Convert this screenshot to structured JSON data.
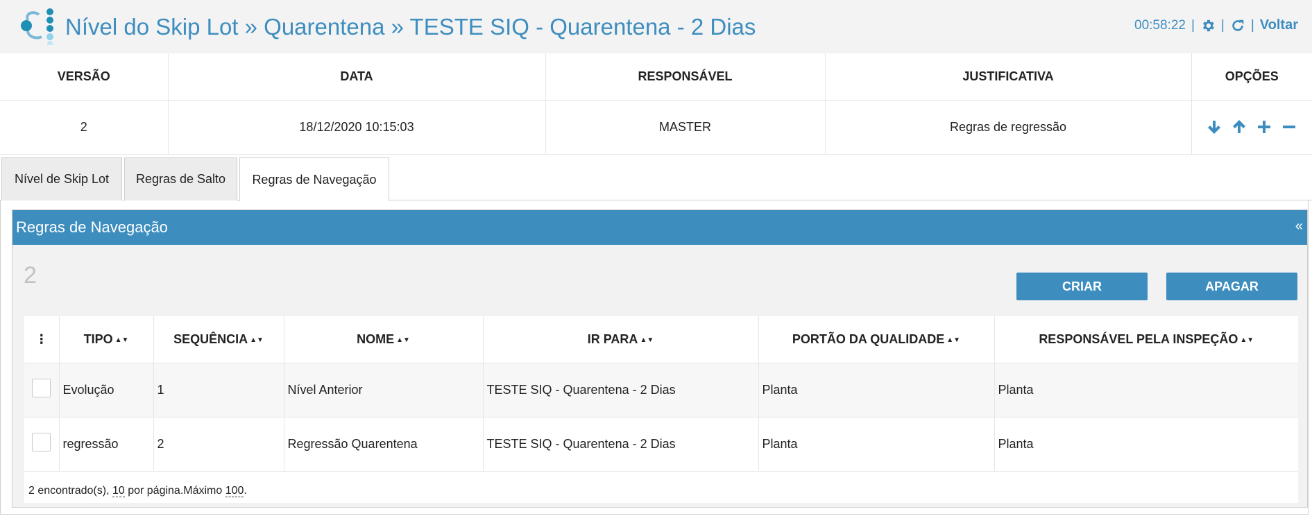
{
  "header": {
    "title": "Nível do Skip Lot » Quarentena » TESTE SIQ - Quarentena - 2 Dias",
    "timer": "00:58:22",
    "sep": "|",
    "voltar": "Voltar",
    "accent": "#3d8dbf"
  },
  "version_table": {
    "headers": [
      "VERSÃO",
      "DATA",
      "RESPONSÁVEL",
      "JUSTIFICATIVA",
      "OPÇÕES"
    ],
    "row": {
      "versao": "2",
      "data": "18/12/2020 10:15:03",
      "responsavel": "MASTER",
      "justificativa": "Regras de regressão"
    },
    "option_icons": [
      "arrow-down-icon",
      "arrow-up-icon",
      "plus-icon",
      "minus-icon"
    ]
  },
  "tabs": [
    {
      "label": "Nível de Skip Lot"
    },
    {
      "label": "Regras de Salto"
    },
    {
      "label": "Regras de Navegação"
    }
  ],
  "panel": {
    "title": "Regras de Navegação",
    "collapse": "«",
    "count": "2",
    "create_label": "CRIAR",
    "delete_label": "APAGAR"
  },
  "data_table": {
    "menu": "⋮",
    "columns": [
      "TIPO",
      "SEQUÊNCIA",
      "NOME",
      "IR PARA",
      "PORTÃO DA QUALIDADE",
      "RESPONSÁVEL PELA INSPEÇÃO"
    ],
    "rows": [
      [
        "Evolução",
        "1",
        "Nível Anterior",
        "TESTE SIQ - Quarentena - 2 Dias",
        "Planta",
        "Planta"
      ],
      [
        "regressão",
        "2",
        "Regressão Quarentena",
        "TESTE SIQ - Quarentena - 2 Dias",
        "Planta",
        "Planta"
      ]
    ],
    "footer": {
      "found": "2 encontrado(s), ",
      "per_page_value": "10",
      "per_page_text": " por página.Máximo ",
      "max_value": "100",
      "end": "."
    }
  }
}
